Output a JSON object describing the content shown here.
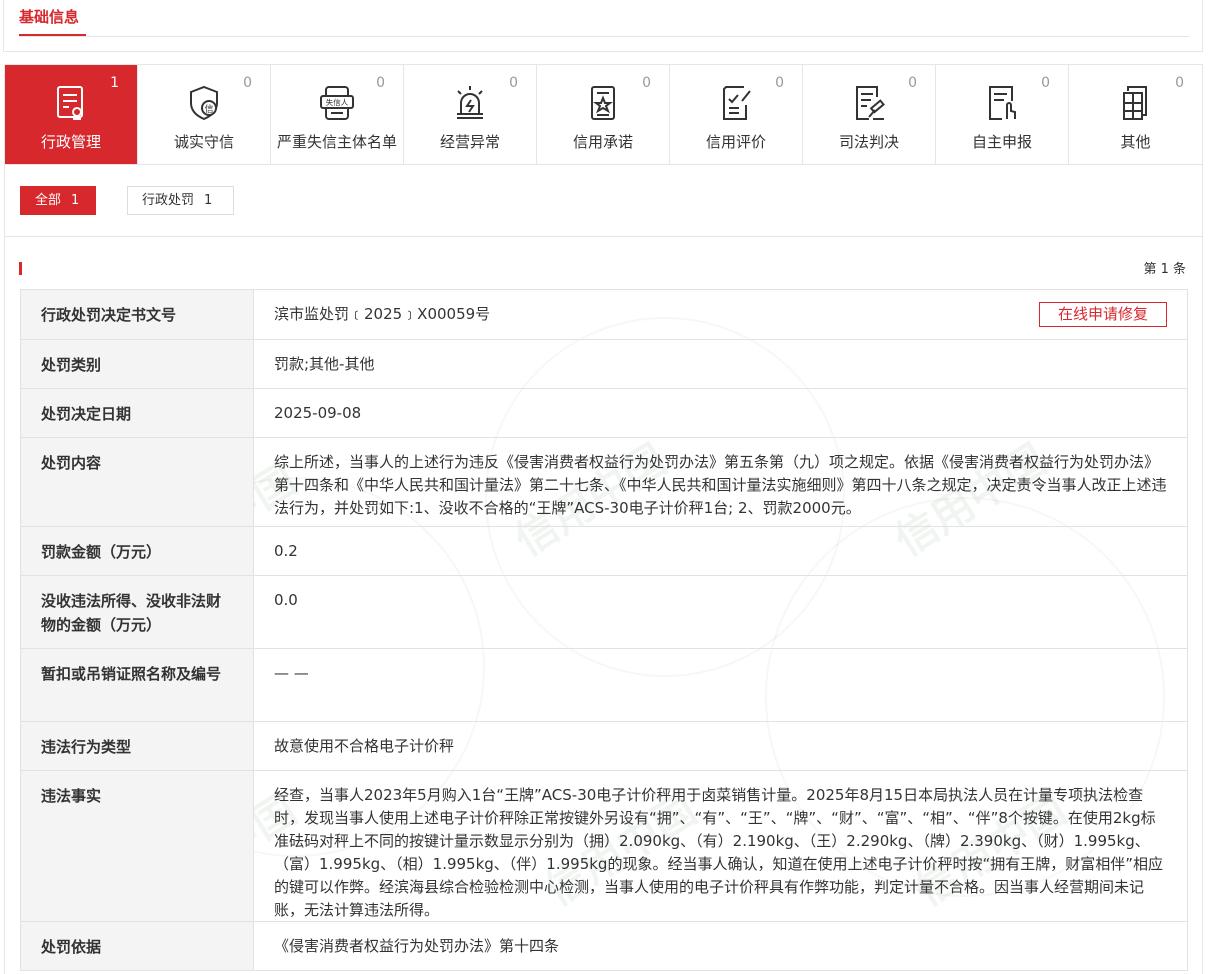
{
  "top": {
    "tab_label": "基础信息"
  },
  "categories": [
    {
      "label": "行政管理",
      "count": "1",
      "icon": "admin-doc-icon"
    },
    {
      "label": "诚实守信",
      "count": "0",
      "icon": "shield-credit-icon"
    },
    {
      "label": "严重失信主体名单",
      "count": "0",
      "icon": "blacklist-icon",
      "badge_text": "失信人"
    },
    {
      "label": "经营异常",
      "count": "0",
      "icon": "alarm-icon"
    },
    {
      "label": "信用承诺",
      "count": "0",
      "icon": "promise-doc-icon"
    },
    {
      "label": "信用评价",
      "count": "0",
      "icon": "evaluation-icon"
    },
    {
      "label": "司法判决",
      "count": "0",
      "icon": "judgment-icon"
    },
    {
      "label": "自主申报",
      "count": "0",
      "icon": "self-report-icon"
    },
    {
      "label": "其他",
      "count": "0",
      "icon": "other-icon"
    }
  ],
  "filters": {
    "all_label": "全部",
    "all_count": "1",
    "xz_label": "行政处罚",
    "xz_count": "1"
  },
  "detail": {
    "count_text": "第 1 条",
    "repair_button": "在线申请修复",
    "watermark": "信用中国",
    "rows": [
      {
        "label": "行政处罚决定书文号",
        "value": "滨市监处罚﹝2025﹞X00059号"
      },
      {
        "label": "处罚类别",
        "value": "罚款;其他-其他"
      },
      {
        "label": "处罚决定日期",
        "value": "2025-09-08"
      },
      {
        "label": "处罚内容",
        "value": "综上所述，当事人的上述行为违反《侵害消费者权益行为处罚办法》第五条第（九）项之规定。依据《侵害消费者权益行为处罚办法》第十四条和《中华人民共和国计量法》第二十七条、《中华人民共和国计量法实施细则》第四十八条之规定，决定责令当事人改正上述违法行为，并处罚如下:1、没收不合格的“王牌”ACS-30电子计价秤1台; 2、罚款2000元。"
      },
      {
        "label": "罚款金额（万元）",
        "value": "0.2"
      },
      {
        "label": "没收违法所得、没收非法财物的金额（万元）",
        "value": "0.0"
      },
      {
        "label": "暂扣或吊销证照名称及编号",
        "value": "— —"
      },
      {
        "label": "违法行为类型",
        "value": "故意使用不合格电子计价秤"
      },
      {
        "label": "违法事实",
        "value": "经查，当事人2023年5月购入1台“王牌”ACS-30电子计价秤用于卤菜销售计量。2025年8月15日本局执法人员在计量专项执法检查时，发现当事人使用上述电子计价秤除正常按键外另设有“拥”、“有”、“王”、“牌”、“财”、“富”、“相”、“伴”8个按键。在使用2kg标准砝码对秤上不同的按键计量示数显示分别为（拥）2.090kg、（有）2.190kg、（王）2.290kg、（牌）2.390kg、（财）1.995kg、（富）1.995kg、（相）1.995kg、（伴）1.995kg的现象。经当事人确认，知道在使用上述电子计价秤时按“拥有王牌，财富相伴”相应的键可以作弊。经滨海县综合检验检测中心检测，当事人使用的电子计价秤具有作弊功能，判定计量不合格。因当事人经营期间未记账，无法计算违法所得。"
      },
      {
        "label": "处罚依据",
        "value": "《侵害消费者权益行为处罚办法》第十四条"
      }
    ]
  },
  "colors": {
    "brand_red": "#d7282e",
    "label_bg": "#f4f4f4",
    "border": "#e2e2e2"
  }
}
